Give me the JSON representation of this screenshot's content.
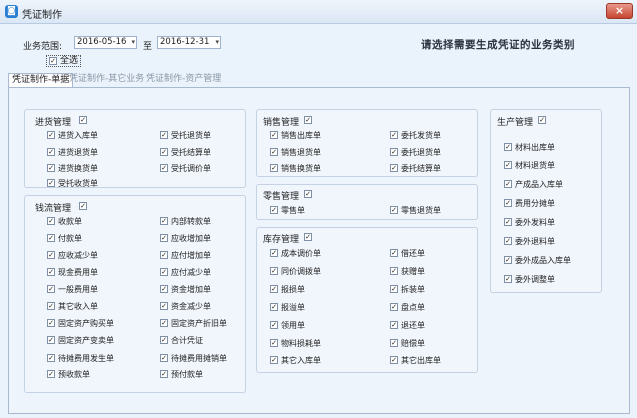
{
  "window": {
    "title": "凭证制作",
    "close": "×"
  },
  "range": {
    "label": "业务范围:",
    "start": "2016-05-16",
    "to": "至",
    "end": "2016-12-31"
  },
  "select_all": "全选",
  "headline": "请选择需要生成凭证的业务类别",
  "tabs": [
    "凭证制作-单据",
    "凭证制作-其它业务",
    "凭证制作-资产管理"
  ],
  "groups": {
    "purchase": {
      "title": "进货管理",
      "items": [
        "进货入库单",
        "受托退货单",
        "进货退货单",
        "受托结算单",
        "进货换货单",
        "受托调价单",
        "受托收货单"
      ]
    },
    "cash": {
      "title": "钱流管理",
      "items": [
        "收款单",
        "内部转款单",
        "付款单",
        "应收增加单",
        "应收减少单",
        "应付增加单",
        "现金费用单",
        "应付减少单",
        "一般费用单",
        "资金增加单",
        "其它收入单",
        "资金减少单",
        "固定资产购买单",
        "固定资产折旧单",
        "固定资产变卖单",
        "合计凭证",
        "待摊费用发生单",
        "待摊费用摊销单",
        "预收款单",
        "预付款单"
      ]
    },
    "sales": {
      "title": "销售管理",
      "items": [
        "销售出库单",
        "委托发货单",
        "销售退货单",
        "委托退货单",
        "销售换货单",
        "委托结算单"
      ]
    },
    "retail": {
      "title": "零售管理",
      "items": [
        "零售单",
        "零售退货单"
      ]
    },
    "inventory": {
      "title": "库存管理",
      "items": [
        "成本调价单",
        "借还单",
        "同价调拨单",
        "获赠单",
        "报损单",
        "拆装单",
        "报溢单",
        "盘点单",
        "领用单",
        "退还单",
        "物料损耗单",
        "赔偿单",
        "其它入库单",
        "其它出库单"
      ]
    },
    "production": {
      "title": "生产管理",
      "items": [
        "材料出库单",
        "材料退货单",
        "产成品入库单",
        "费用分摊单",
        "委外发料单",
        "委外退料单",
        "委外成品入库单",
        "委外调整单"
      ]
    }
  },
  "checks": "✓"
}
